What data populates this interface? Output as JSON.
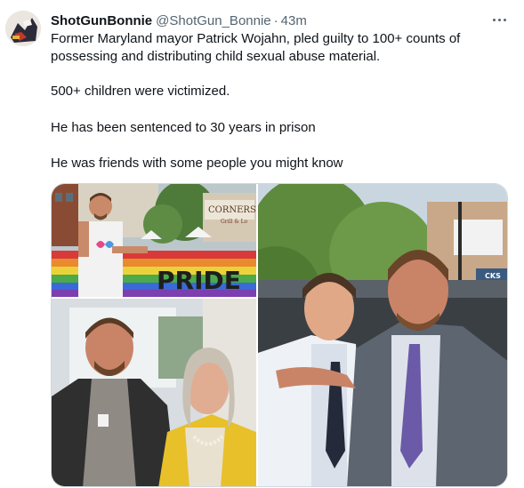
{
  "tweet": {
    "display_name": "ShotGunBonnie",
    "handle": "@ShotGun_Bonnie",
    "separator": "·",
    "time": "43m",
    "text_line1": "Former Maryland mayor Patrick Wojahn, pled guilty to 100+ counts of possessing and distributing child sexual abuse material.",
    "text_line2": "500+ children were victimized.",
    "text_line3": "He has been sentenced to 30 years in prison",
    "text_line4": "He was friends with some people you might know"
  },
  "media": {
    "photo1_signs": [
      "CORNERSTO",
      "Grill & Lo",
      "PRIDE"
    ],
    "photo3_signs": [
      "CKS"
    ]
  },
  "icons": {
    "more": "more-horizontal-icon"
  },
  "colors": {
    "text": "#0f1419",
    "secondary": "#536471",
    "border": "#cfd9de"
  }
}
